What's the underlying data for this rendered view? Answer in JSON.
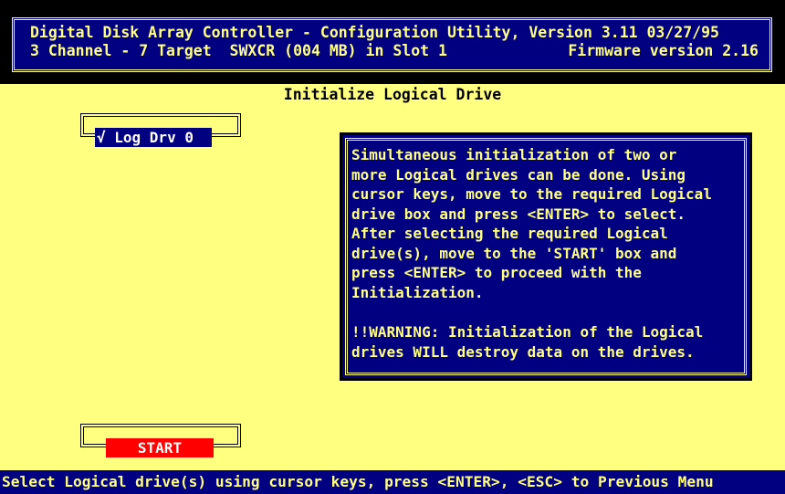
{
  "header": {
    "line1": "Digital Disk Array Controller - Configuration Utility, Version 3.11 03/27/95",
    "line2_left": "3 Channel - 7 Target  SWXCR (004 MB) in Slot 1",
    "line2_right": "Firmware version 2.16"
  },
  "page_title": "Initialize Logical Drive",
  "drives": [
    {
      "label": "√ Log Drv 0",
      "selected": true
    }
  ],
  "info_box": {
    "lines": [
      "Simultaneous initialization of two or",
      "more Logical drives can be done. Using",
      "cursor keys, move to the required Logical",
      "drive box and press <ENTER> to select.",
      "After selecting the required Logical",
      "drive(s), move to the 'START' box and",
      "press <ENTER> to proceed with the",
      "Initialization."
    ],
    "warning_lines": [
      "!!WARNING: Initialization of the Logical",
      "drives WILL destroy data on the drives."
    ]
  },
  "start_button": {
    "label": "START"
  },
  "status_bar": "Select Logical drive(s) using cursor keys, press <ENTER>, <ESC> to Previous Menu",
  "colors": {
    "background": "#FFFF80",
    "panel": "#000080",
    "text_on_panel": "#FFFF80",
    "start_button": "#FF0000",
    "frame": "#000000"
  }
}
